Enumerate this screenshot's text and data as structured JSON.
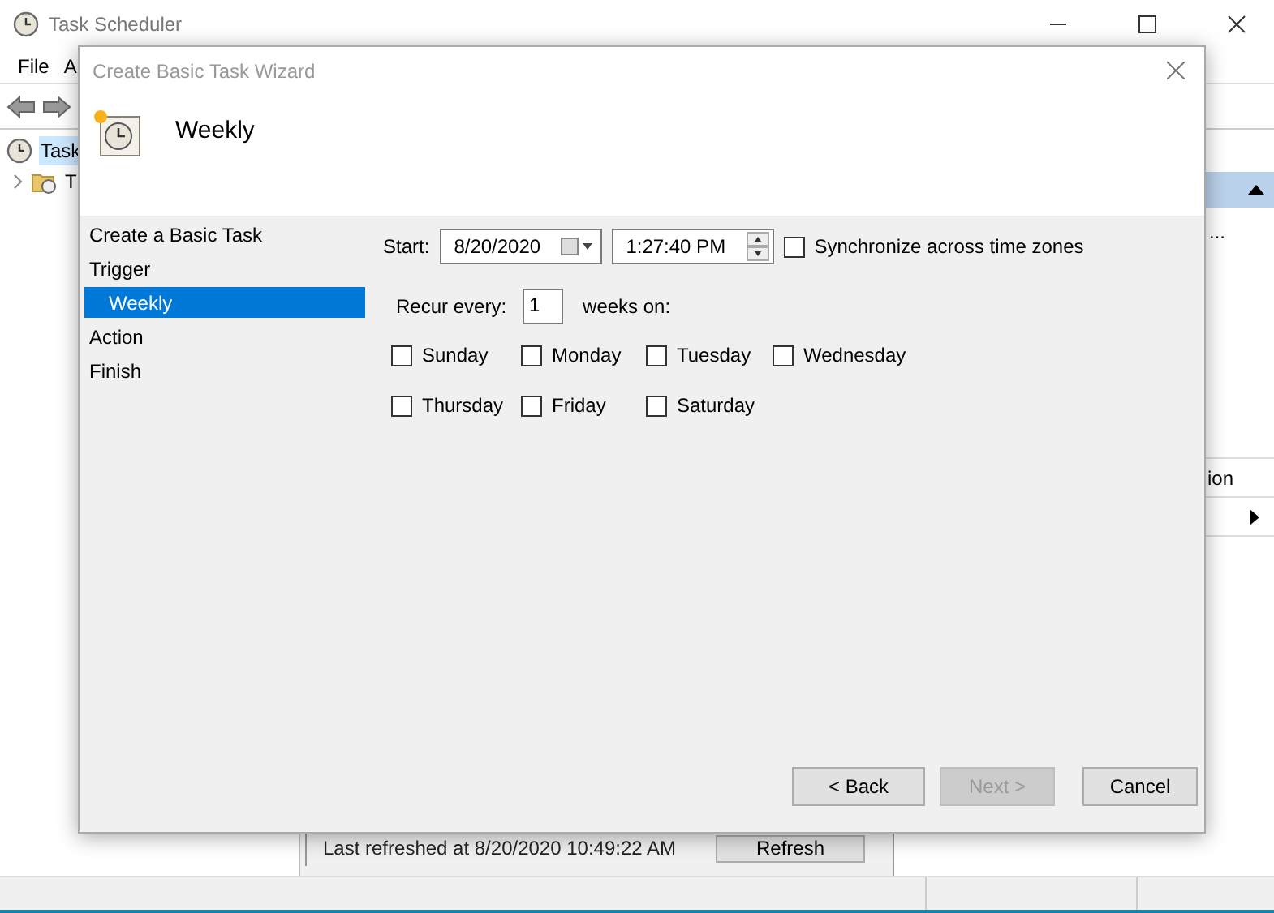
{
  "app": {
    "title": "Task Scheduler",
    "menu": [
      "File",
      "A"
    ],
    "tree": [
      {
        "label": "Task",
        "selected": true,
        "children": [
          {
            "label": "T",
            "selected": false
          }
        ]
      }
    ],
    "refresh": {
      "text": "Last refreshed at 8/20/2020 10:49:22 AM",
      "button": "Refresh"
    },
    "actions": [
      "...",
      "ion"
    ]
  },
  "dialog": {
    "title": "Create Basic Task Wizard",
    "heading": "Weekly",
    "steps": [
      {
        "label": "Create a Basic Task",
        "selected": false
      },
      {
        "label": "Trigger",
        "selected": false,
        "children": [
          {
            "label": "Weekly",
            "selected": true
          }
        ]
      },
      {
        "label": "Action",
        "selected": false
      },
      {
        "label": "Finish",
        "selected": false
      }
    ],
    "form": {
      "start_label": "Start:",
      "date": "8/20/2020",
      "time": "1:27:40 PM",
      "sync": {
        "label": "Synchronize across time zones",
        "checked": false
      },
      "recur_label": "Recur every:",
      "recur_value": "1",
      "recur_suffix": "weeks on:",
      "days": [
        {
          "label": "Sunday",
          "checked": false
        },
        {
          "label": "Monday",
          "checked": false
        },
        {
          "label": "Tuesday",
          "checked": false
        },
        {
          "label": "Wednesday",
          "checked": false
        },
        {
          "label": "Thursday",
          "checked": false
        },
        {
          "label": "Friday",
          "checked": false
        },
        {
          "label": "Saturday",
          "checked": false
        }
      ]
    },
    "buttons": [
      {
        "label": "< Back",
        "disabled": false
      },
      {
        "label": "Next >",
        "disabled": true
      },
      {
        "label": "Cancel",
        "disabled": false
      }
    ]
  }
}
